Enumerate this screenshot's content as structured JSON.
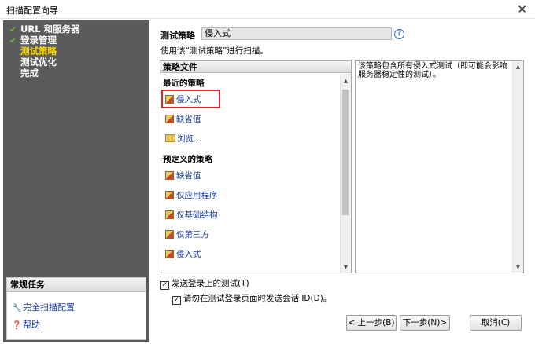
{
  "window": {
    "title": "扫描配置向导",
    "close": "✕"
  },
  "sidebar": {
    "steps": [
      {
        "label": "URL 和服务器",
        "done": true
      },
      {
        "label": "登录管理",
        "done": true
      },
      {
        "label": "测试策略",
        "active": true
      },
      {
        "label": "测试优化"
      },
      {
        "label": "完成"
      }
    ],
    "tasks": {
      "header": "常规任务",
      "items": [
        {
          "label": "完全扫描配置",
          "icon": "wrench-icon"
        },
        {
          "label": "帮助",
          "icon": "help-icon"
        }
      ]
    }
  },
  "policy": {
    "label": "测试策略",
    "value": "侵入式",
    "help": "?",
    "usage": "使用该“测试策略”进行扫描。"
  },
  "policy_files": {
    "header": "策略文件",
    "recent_header": "最近的策略",
    "recent": [
      "侵入式",
      "缺省值",
      "浏览..."
    ],
    "predefined_header": "预定义的策略",
    "predefined": [
      "缺省值",
      "仅应用程序",
      "仅基础结构",
      "仅第三方",
      "侵入式"
    ]
  },
  "description": "该策略包含所有侵入式测试（即可能会影响服务器稳定性的测试）。",
  "options": {
    "send_login_tests": {
      "label": "发送登录上的测试(T)",
      "checked": true
    },
    "no_session_id": {
      "label": "请勿在测试登录页面时发送会话 ID(D)。",
      "checked": true
    }
  },
  "buttons": {
    "back": "< 上一步(B)",
    "next": "下一步(N)>",
    "cancel": "取消(C)"
  },
  "colors": {
    "sidebar_bg": "#5b5b5b",
    "active_step": "#ffd700",
    "link": "#1a3fa0",
    "highlight": "#e0262b"
  }
}
